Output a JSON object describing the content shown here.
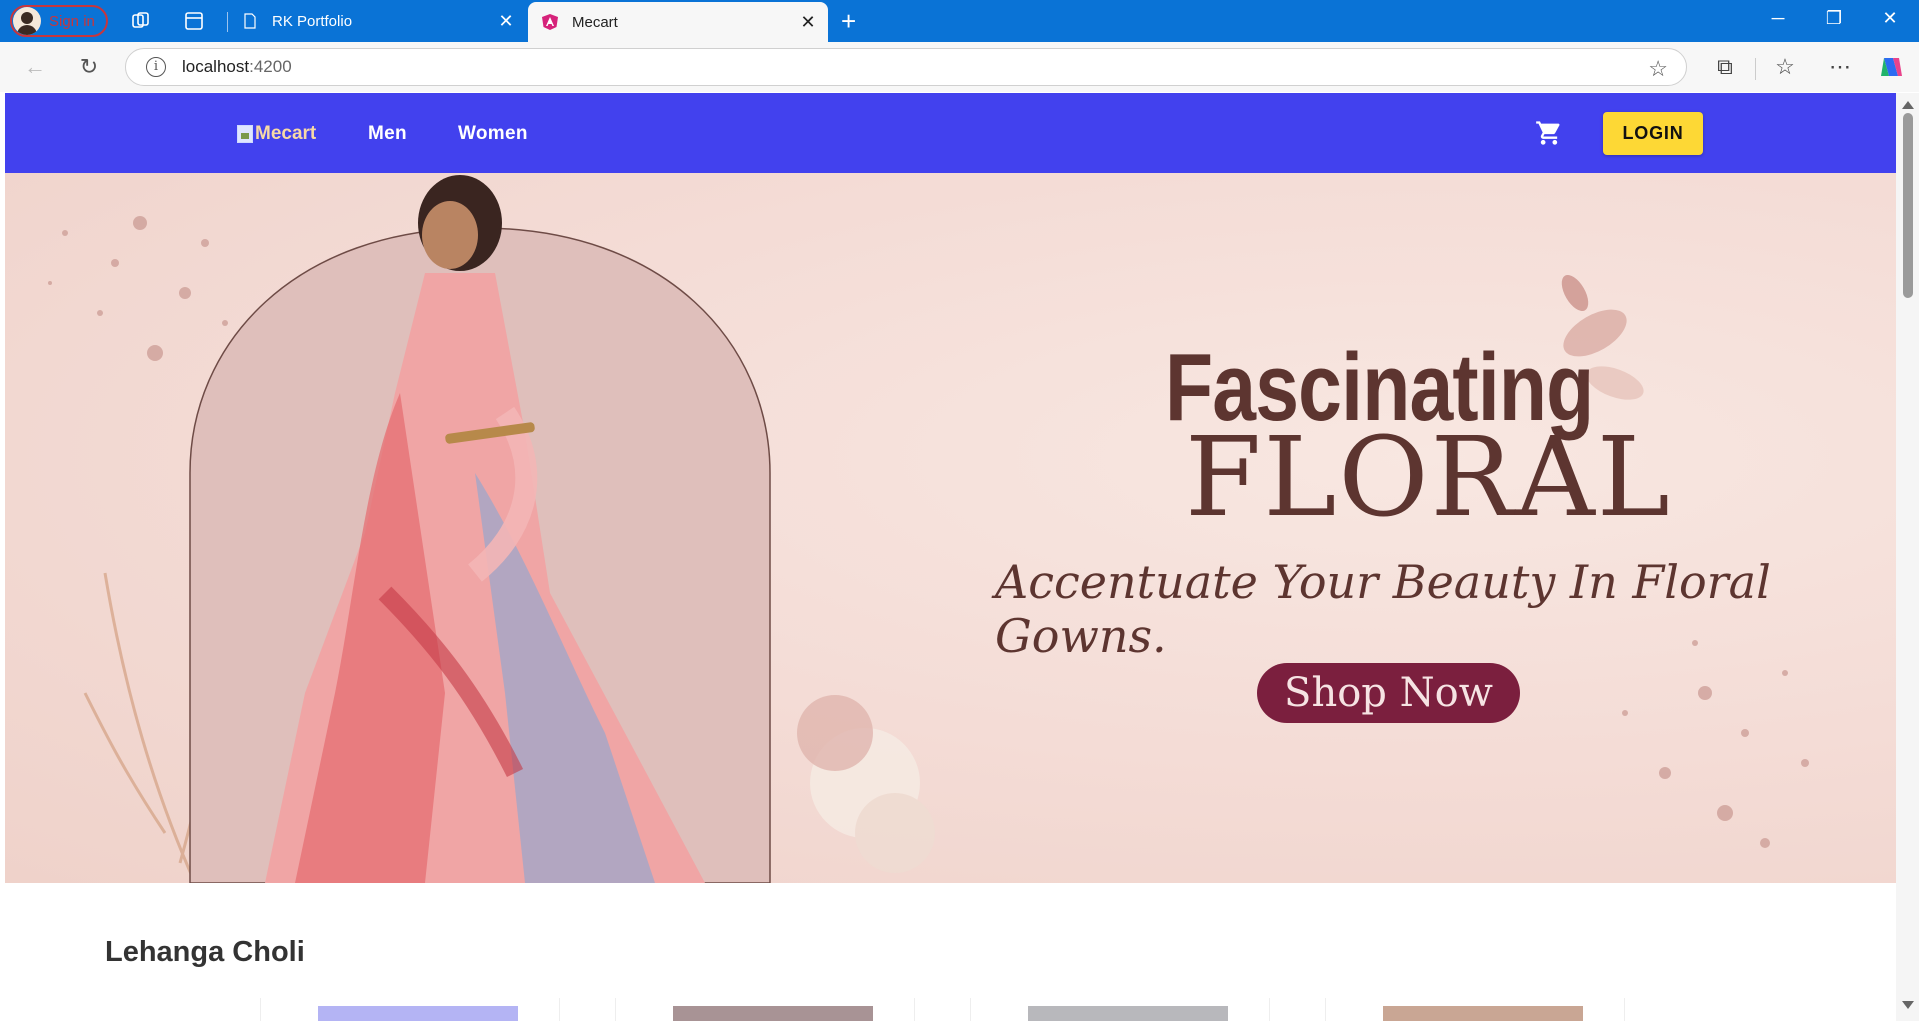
{
  "browser": {
    "profile_label": "Sign in",
    "tabs": [
      {
        "title": "RK Portfolio",
        "active": false
      },
      {
        "title": "Mecart",
        "active": true
      }
    ],
    "url_host": "localhost",
    "url_port": ":4200"
  },
  "navbar": {
    "brand": "Mecart",
    "links": [
      "Men",
      "Women"
    ],
    "login_label": "LOGIN",
    "bg_color": "#4241ee",
    "login_color": "#fdd835"
  },
  "hero": {
    "title_line1": "Fascinating",
    "title_line2": "FLORAL",
    "tagline": "Accentuate Your Beauty In Floral Gowns.",
    "cta_label": "Shop Now",
    "cta_color": "#7b1f3e"
  },
  "section": {
    "title": "Lehanga Choli"
  }
}
